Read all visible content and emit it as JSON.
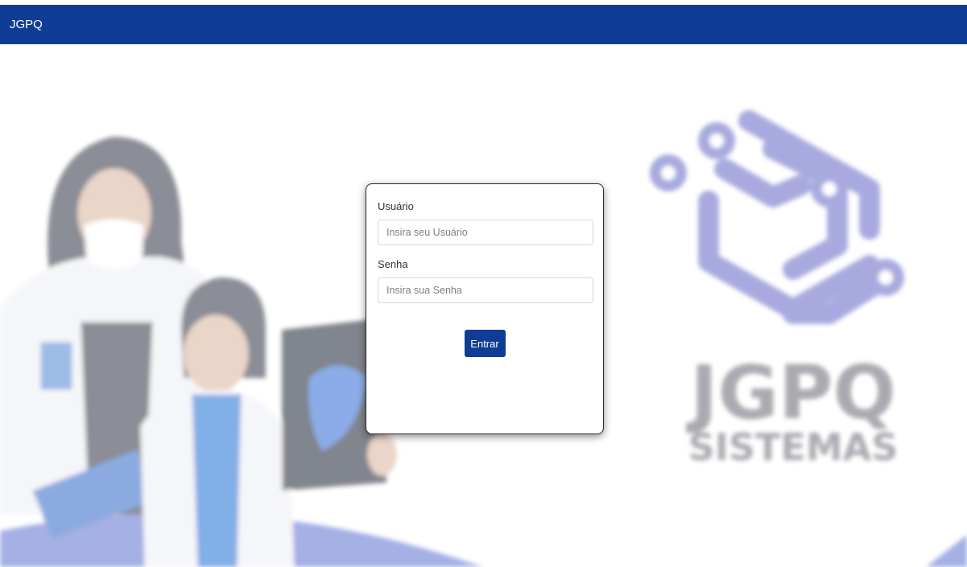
{
  "navbar": {
    "brand": "JGPQ"
  },
  "login": {
    "user_label": "Usuário",
    "user_placeholder": "Insira seu Usuário",
    "user_value": "",
    "password_label": "Senha",
    "password_placeholder": "Insira sua Senha",
    "password_value": "",
    "submit_label": "Entrar"
  },
  "logo": {
    "line1": "JGPQ",
    "line2": "SISTEMAS"
  },
  "colors": {
    "navbar": "#0f3d95",
    "button": "#0f3d95",
    "logo_icon": "#9a9bd9",
    "logo_text": "#9b9ba3"
  }
}
